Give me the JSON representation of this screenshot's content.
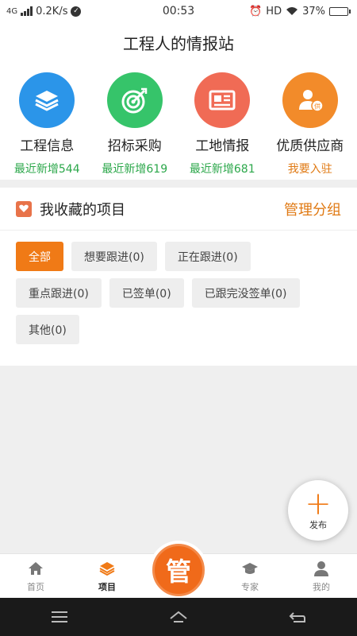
{
  "status": {
    "network_type": "4G",
    "speed": "0.2K/s",
    "time": "00:53",
    "hd": "HD",
    "battery": "37%",
    "battery_level": 0.37
  },
  "header": {
    "title": "工程人的情报站"
  },
  "categories": [
    {
      "title": "工程信息",
      "subtitle": "最近新增544",
      "icon": "layers-icon",
      "color": "#2b95e9"
    },
    {
      "title": "招标采购",
      "subtitle": "最近新增619",
      "icon": "target-icon",
      "color": "#36c46a"
    },
    {
      "title": "工地情报",
      "subtitle": "最近新增681",
      "icon": "newspaper-icon",
      "color": "#f06b55"
    },
    {
      "title": "优质供应商",
      "subtitle": "我要入驻",
      "icon": "supplier-icon",
      "color": "#f28b2a"
    }
  ],
  "favorites": {
    "title": "我收藏的项目",
    "manage": "管理分组",
    "tags": [
      {
        "label": "全部",
        "active": true
      },
      {
        "label": "想要跟进(0)"
      },
      {
        "label": "正在跟进(0)"
      },
      {
        "label": "重点跟进(0)"
      },
      {
        "label": "已签单(0)"
      },
      {
        "label": "已跟完没签单(0)"
      },
      {
        "label": "其他(0)"
      }
    ]
  },
  "fab": {
    "label": "发布"
  },
  "center_button": {
    "label": "管"
  },
  "bottom_nav": [
    {
      "label": "首页",
      "icon": "home-icon"
    },
    {
      "label": "项目",
      "icon": "layers-icon",
      "active": true
    },
    {
      "label": "专家",
      "icon": "graduation-cap-icon"
    },
    {
      "label": "我的",
      "icon": "person-icon"
    }
  ],
  "accent_color": "#f07a16"
}
